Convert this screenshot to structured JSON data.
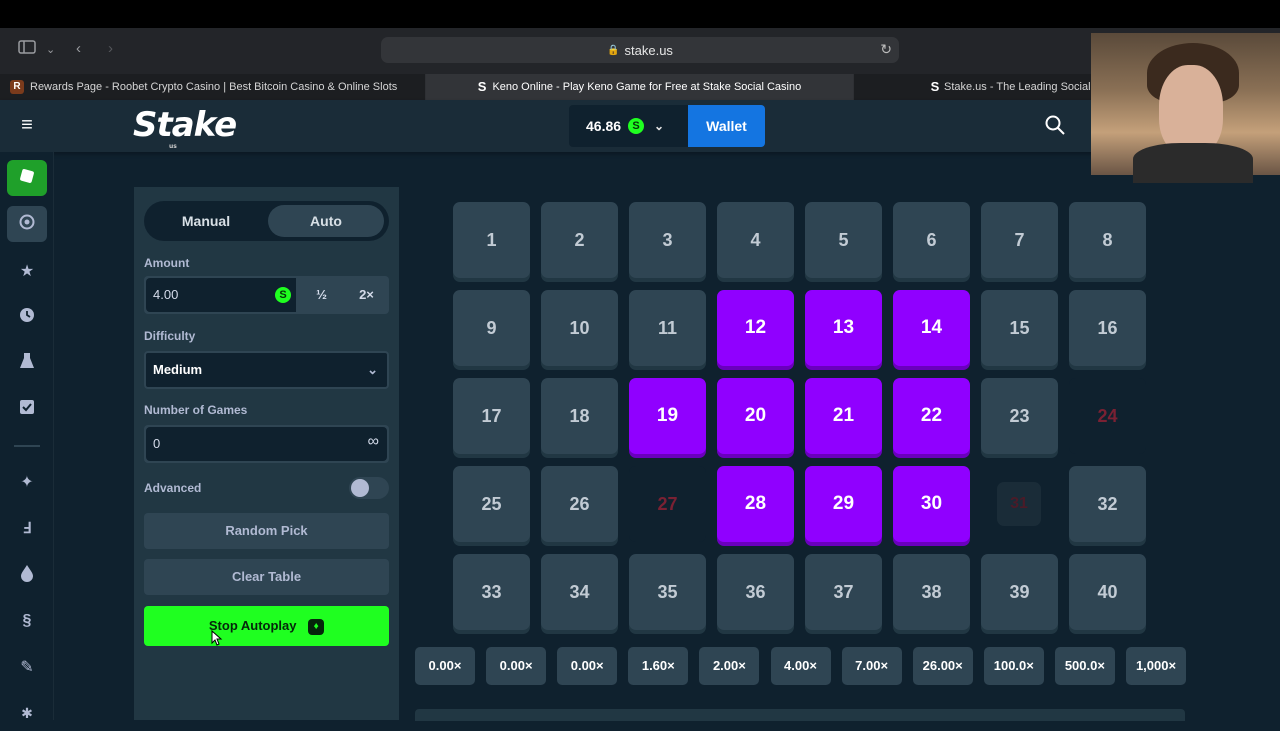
{
  "browser": {
    "url": "stake.us",
    "tabs": [
      {
        "label": "Rewards Page - Roobet Crypto Casino | Best Bitcoin Casino & Online Slots",
        "favicon": "R"
      },
      {
        "label": "Keno Online - Play Keno Game for Free at Stake Social Casino",
        "favicon": "S"
      },
      {
        "label": "Stake.us - The Leading Social C",
        "favicon": "S"
      }
    ]
  },
  "header": {
    "logo": "Stake",
    "logo_sub": "us",
    "balance": "46.86",
    "currency_symbol": "S",
    "wallet_label": "Wallet"
  },
  "sidebar": {
    "icons": [
      "casino-icon",
      "sports-icon",
      "star-icon",
      "clock-icon",
      "flask-icon",
      "check-square-icon",
      "sparkle-icon",
      "lightning-icon",
      "drop-icon",
      "shield-icon",
      "pen-icon",
      "star-small-icon"
    ]
  },
  "panel": {
    "mode_manual": "Manual",
    "mode_auto": "Auto",
    "amount_label": "Amount",
    "amount_value": "4.00",
    "half_label": "½",
    "double_label": "2×",
    "difficulty_label": "Difficulty",
    "difficulty_value": "Medium",
    "games_label": "Number of Games",
    "games_value": "0",
    "infinity_symbol": "∞",
    "advanced_label": "Advanced",
    "random_pick_label": "Random Pick",
    "clear_table_label": "Clear Table",
    "stop_autoplay_label": "Stop Autoplay"
  },
  "board": {
    "tiles": [
      {
        "n": "1",
        "state": "normal"
      },
      {
        "n": "2",
        "state": "normal"
      },
      {
        "n": "3",
        "state": "normal"
      },
      {
        "n": "4",
        "state": "normal"
      },
      {
        "n": "5",
        "state": "normal"
      },
      {
        "n": "6",
        "state": "normal"
      },
      {
        "n": "7",
        "state": "normal"
      },
      {
        "n": "8",
        "state": "normal"
      },
      {
        "n": "9",
        "state": "normal"
      },
      {
        "n": "10",
        "state": "normal"
      },
      {
        "n": "11",
        "state": "normal"
      },
      {
        "n": "12",
        "state": "picked"
      },
      {
        "n": "13",
        "state": "picked"
      },
      {
        "n": "14",
        "state": "picked"
      },
      {
        "n": "15",
        "state": "normal"
      },
      {
        "n": "16",
        "state": "normal"
      },
      {
        "n": "17",
        "state": "normal"
      },
      {
        "n": "18",
        "state": "normal"
      },
      {
        "n": "19",
        "state": "picked"
      },
      {
        "n": "20",
        "state": "picked"
      },
      {
        "n": "21",
        "state": "picked"
      },
      {
        "n": "22",
        "state": "picked"
      },
      {
        "n": "23",
        "state": "normal"
      },
      {
        "n": "24",
        "state": "miss"
      },
      {
        "n": "25",
        "state": "normal"
      },
      {
        "n": "26",
        "state": "normal"
      },
      {
        "n": "27",
        "state": "miss"
      },
      {
        "n": "28",
        "state": "picked"
      },
      {
        "n": "29",
        "state": "picked"
      },
      {
        "n": "30",
        "state": "picked"
      },
      {
        "n": "31",
        "state": "miss-small"
      },
      {
        "n": "32",
        "state": "normal"
      },
      {
        "n": "33",
        "state": "normal"
      },
      {
        "n": "34",
        "state": "normal"
      },
      {
        "n": "35",
        "state": "normal"
      },
      {
        "n": "36",
        "state": "normal"
      },
      {
        "n": "37",
        "state": "normal"
      },
      {
        "n": "38",
        "state": "normal"
      },
      {
        "n": "39",
        "state": "normal"
      },
      {
        "n": "40",
        "state": "normal"
      }
    ],
    "payouts": [
      "0.00×",
      "0.00×",
      "0.00×",
      "1.60×",
      "2.00×",
      "4.00×",
      "7.00×",
      "26.00×",
      "100.0×",
      "500.0×",
      "1,000×"
    ]
  },
  "colors": {
    "accent_green": "#1fff20",
    "picked_purple": "#9000ff",
    "wallet_blue": "#1475e1"
  }
}
